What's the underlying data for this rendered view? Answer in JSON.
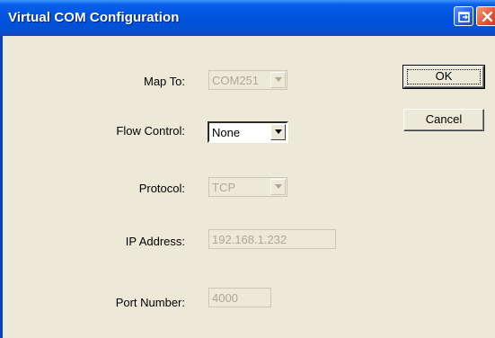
{
  "window": {
    "title": "Virtual COM Configuration",
    "title_color": "#ffffff",
    "titlebar_color": "#0054e3",
    "body_color": "#ece9d8"
  },
  "icons": {
    "titlebar_extra": "window-restore-icon",
    "titlebar_close": "close-icon",
    "dropdown": "chevron-down-icon"
  },
  "form": {
    "map_to": {
      "label": "Map To:",
      "value": "COM251",
      "enabled": false
    },
    "flow_control": {
      "label": "Flow Control:",
      "value": "None",
      "enabled": true
    },
    "protocol": {
      "label": "Protocol:",
      "value": "TCP",
      "enabled": false
    },
    "ip_address": {
      "label": "IP Address:",
      "value": "192.168.1.232",
      "enabled": false
    },
    "port_number": {
      "label": "Port Number:",
      "value": "4000",
      "enabled": false
    }
  },
  "buttons": {
    "ok_label": "OK",
    "cancel_label": "Cancel"
  }
}
